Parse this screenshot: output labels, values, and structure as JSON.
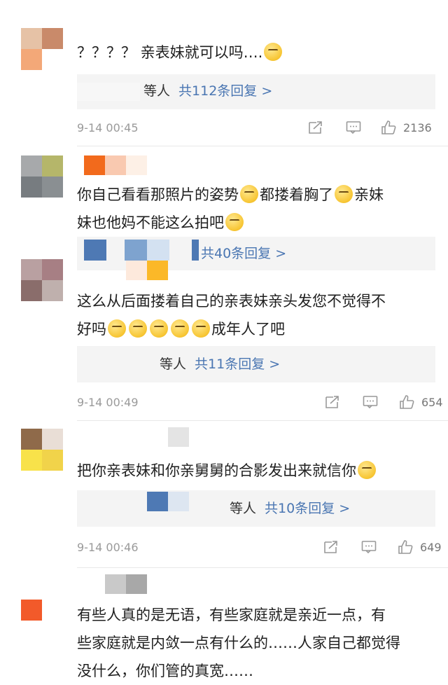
{
  "comments": [
    {
      "text_lines": [
        "？？？？ 亲表妹就可以吗…."
      ],
      "replies": {
        "who": "等人",
        "link": "共112条回复 >"
      },
      "date": "9-14 00:45",
      "likes": "2136"
    },
    {
      "text_lines": [
        "你自己看看那照片的姿势",
        "都搂着胸了",
        "亲妹",
        "妹也他妈不能这么拍吧"
      ],
      "replies": {
        "who": "",
        "link": "共40条回复 >"
      },
      "date": "",
      "likes": ""
    },
    {
      "text_lines": [
        "这么从后面搂着自己的亲表妹亲头发您不觉得不",
        "好吗",
        "成年人了吧"
      ],
      "replies": {
        "who": "等人",
        "link": "共11条回复 >"
      },
      "date": "9-14 00:49",
      "likes": "654"
    },
    {
      "text_lines": [
        "把你亲表妹和你亲舅舅的合影发出来就信你"
      ],
      "replies": {
        "who": "等人",
        "link": "共10条回复 >"
      },
      "date": "9-14 00:46",
      "likes": "649"
    },
    {
      "text_lines": [
        "有些人真的是无语，有些家庭就是亲近一点，有",
        "些家庭就是内敛一点有什么的……人家自己都觉得",
        "没什么，你们管的真宽……"
      ],
      "replies": null,
      "date": "",
      "likes": ""
    }
  ],
  "colors": {
    "link": "#4a76b2",
    "reply_bg": "#f4f4f4",
    "meta_text": "#9a9a9a"
  },
  "icons": [
    "share-icon",
    "comment-icon",
    "like-icon",
    "emoji-icon"
  ]
}
